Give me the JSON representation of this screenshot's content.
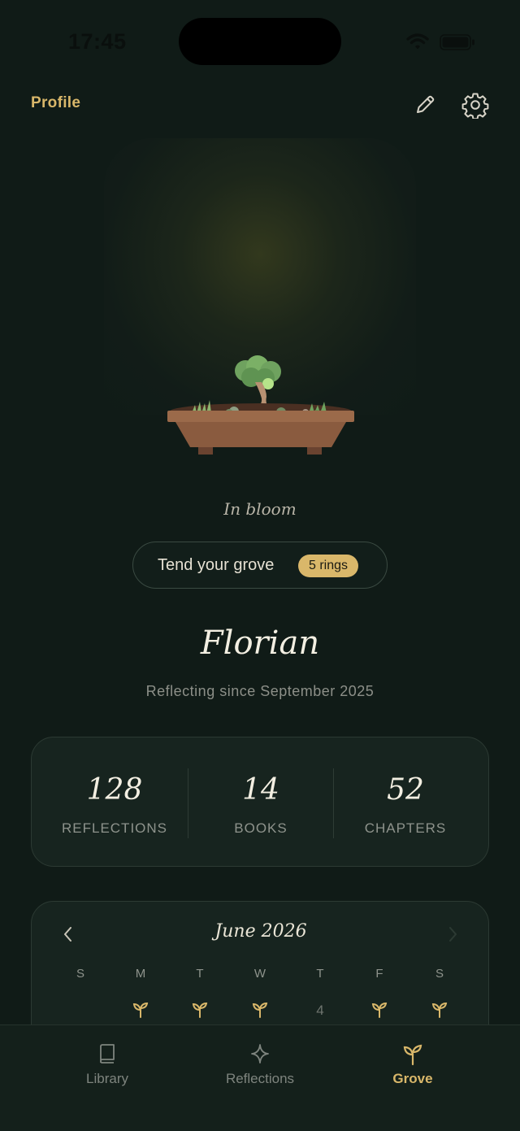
{
  "status_bar": {
    "time": "17:45"
  },
  "header": {
    "title": "Profile"
  },
  "hero": {
    "status": "In bloom"
  },
  "tend": {
    "label": "Tend your grove",
    "badge": "5 rings"
  },
  "user": {
    "name": "Florian",
    "since": "Reflecting since September 2025"
  },
  "stats": [
    {
      "value": "128",
      "label": "REFLECTIONS"
    },
    {
      "value": "14",
      "label": "BOOKS"
    },
    {
      "value": "52",
      "label": "CHAPTERS"
    }
  ],
  "calendar": {
    "month": "June 2026",
    "weekdays": [
      "S",
      "M",
      "T",
      "W",
      "T",
      "F",
      "S"
    ],
    "first_row": [
      "",
      "sprout",
      "sprout",
      "sprout",
      "4",
      "sprout",
      "sprout"
    ]
  },
  "tabs": [
    {
      "label": "Library",
      "icon": "book-icon",
      "active": false
    },
    {
      "label": "Reflections",
      "icon": "sparkle-icon",
      "active": false
    },
    {
      "label": "Grove",
      "icon": "sprout-icon",
      "active": true
    }
  ],
  "colors": {
    "accent": "#d9b76a",
    "background": "#101b17",
    "card": "#17241f"
  }
}
